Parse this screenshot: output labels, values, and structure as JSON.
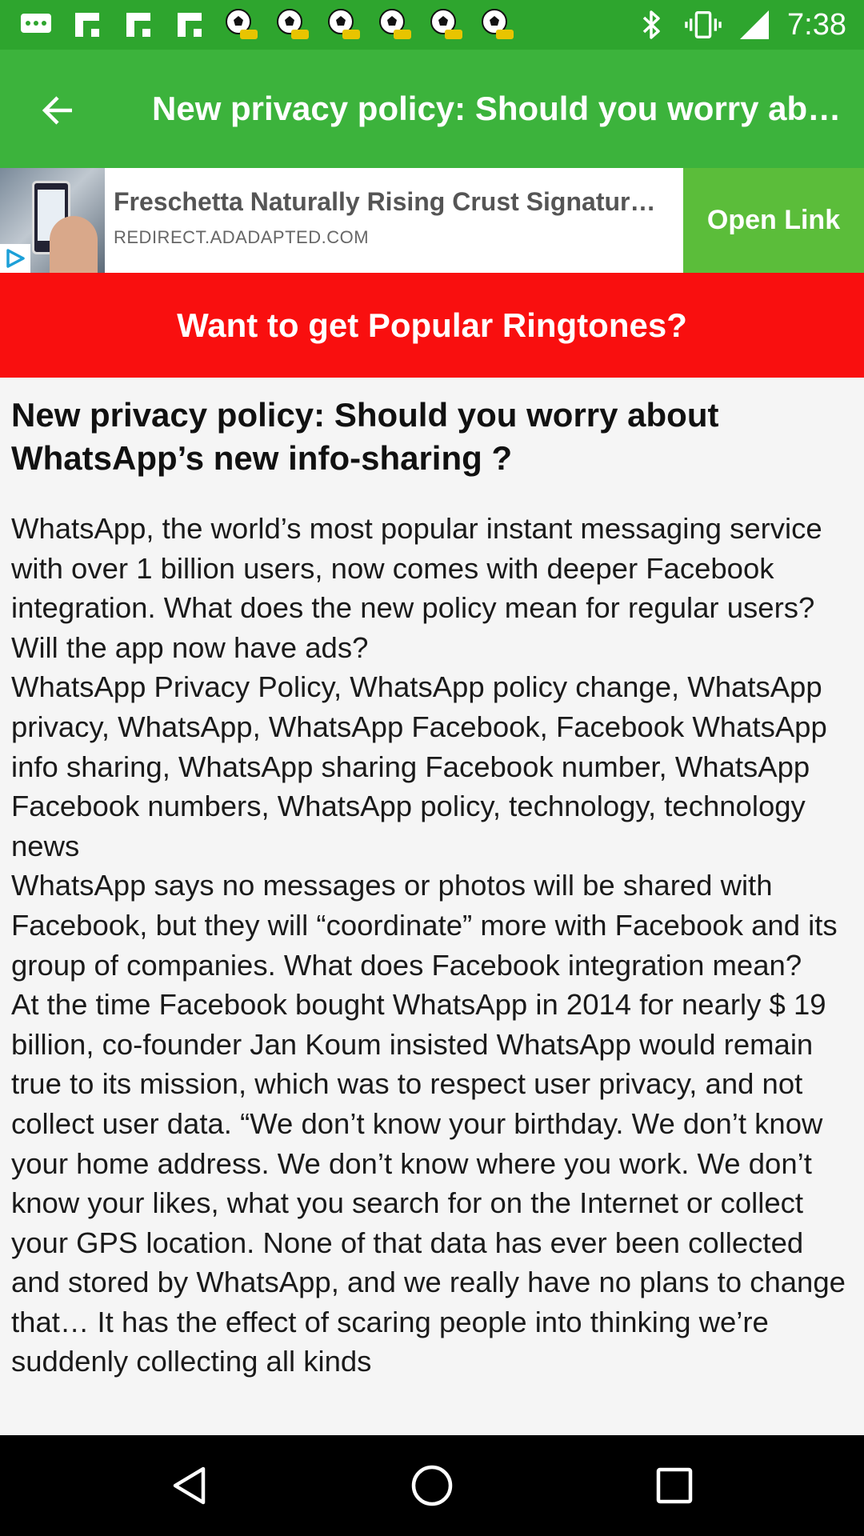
{
  "status_bar": {
    "time": "7:38",
    "left_icons": [
      "messages-icon",
      "flipboard-icon",
      "flipboard-icon",
      "flipboard-icon",
      "soccer-ball-icon",
      "soccer-ball-icon",
      "soccer-ball-icon",
      "soccer-ball-icon",
      "soccer-ball-icon",
      "soccer-ball-icon"
    ],
    "right_icons": [
      "bluetooth-icon",
      "vibrate-icon",
      "signal-icon"
    ]
  },
  "app_bar": {
    "title": "New privacy policy: Should you worry about WhatsApp’s new info-sharing ?",
    "back_icon": "arrow-back-icon"
  },
  "ad": {
    "title": "Freschetta Naturally Rising Crust Signature Pizza",
    "url": "REDIRECT.ADADAPTED.COM",
    "button_label": "Open Link"
  },
  "promo": {
    "label": "Want to get Popular Ringtones?"
  },
  "article": {
    "title": "New privacy policy: Should you worry about WhatsApp’s new info-sharing ?",
    "body": "WhatsApp, the world’s most popular instant messaging service with over 1 billion users, now comes with deeper Facebook integration. What does the new policy mean for regular users? Will the app now have ads?\nWhatsApp Privacy Policy, WhatsApp policy change, WhatsApp privacy, WhatsApp, WhatsApp Facebook, Facebook WhatsApp info sharing, WhatsApp sharing Facebook number, WhatsApp Facebook numbers, WhatsApp policy, technology, technology news\nWhatsApp says no messages or photos will be shared with Facebook, but they will “coordinate” more with Facebook and its group of companies. What does Facebook integration mean?\nAt the time Facebook bought WhatsApp in 2014 for nearly $ 19 billion, co-founder Jan Koum insisted WhatsApp would remain true to its mission, which was to respect user privacy, and not collect user data. “We don’t know your birthday. We don’t know your home address. We don’t know where you work. We don’t know your likes, what you search for on the Internet or collect your GPS location. None of that data has ever been collected and stored by WhatsApp, and we really have no plans to change that… It has the effect of scaring people into thinking we’re suddenly collecting all kinds"
  },
  "nav_bar": {
    "icons": [
      "back-triangle-icon",
      "home-circle-icon",
      "recents-square-icon"
    ]
  },
  "colors": {
    "status_bar": "#2ea52e",
    "app_bar": "#3cb33c",
    "open_link": "#5bbd3a",
    "promo": "#f90f0f"
  }
}
